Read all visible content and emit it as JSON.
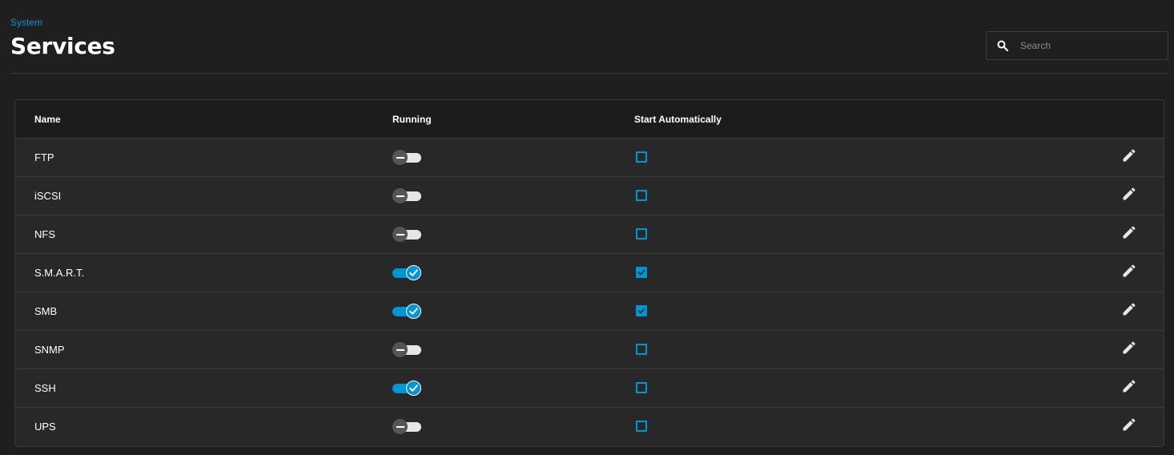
{
  "breadcrumb": "System",
  "title": "Services",
  "search": {
    "placeholder": "Search",
    "value": ""
  },
  "table": {
    "columns": {
      "name": "Name",
      "running": "Running",
      "start_automatically": "Start Automatically"
    },
    "rows": [
      {
        "name": "FTP",
        "running": false,
        "start_automatically": false
      },
      {
        "name": "iSCSI",
        "running": false,
        "start_automatically": false
      },
      {
        "name": "NFS",
        "running": false,
        "start_automatically": false
      },
      {
        "name": "S.M.A.R.T.",
        "running": true,
        "start_automatically": true
      },
      {
        "name": "SMB",
        "running": true,
        "start_automatically": true
      },
      {
        "name": "SNMP",
        "running": false,
        "start_automatically": false
      },
      {
        "name": "SSH",
        "running": true,
        "start_automatically": false
      },
      {
        "name": "UPS",
        "running": false,
        "start_automatically": false
      }
    ]
  },
  "icons": {
    "search": "search-icon",
    "edit": "pencil-icon"
  },
  "colors": {
    "accent": "#0095d5",
    "background": "#1f1f1f",
    "card": "#282828",
    "header": "#1c1c1c"
  }
}
